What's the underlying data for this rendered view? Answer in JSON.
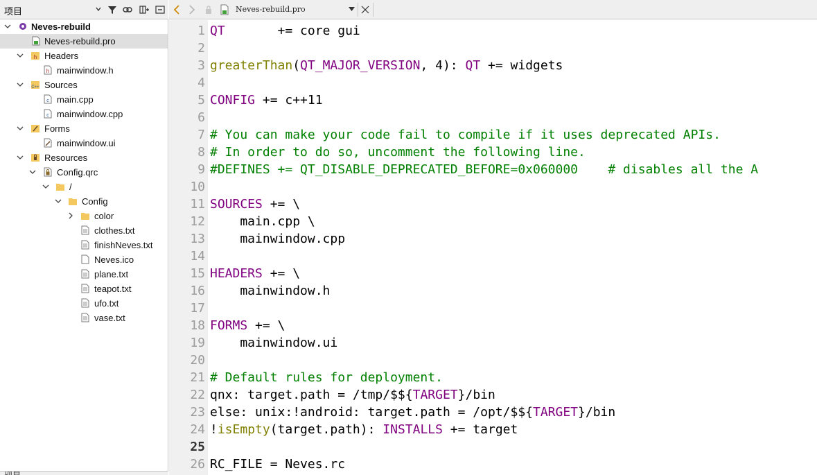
{
  "project_panel": {
    "title": "项目",
    "bottom_title": "项目",
    "tree": [
      {
        "label": "Neves-rebuild",
        "icon": "project-icon",
        "expanded": true,
        "bold": true
      },
      {
        "label": "Neves-rebuild.pro",
        "icon": "pro-file-icon",
        "selected": true
      },
      {
        "label": "Headers",
        "icon": "headers-folder-icon",
        "expanded": true
      },
      {
        "label": "mainwindow.h",
        "icon": "header-file-icon"
      },
      {
        "label": "Sources",
        "icon": "sources-folder-icon",
        "expanded": true
      },
      {
        "label": "main.cpp",
        "icon": "cpp-file-icon"
      },
      {
        "label": "mainwindow.cpp",
        "icon": "cpp-file-icon"
      },
      {
        "label": "Forms",
        "icon": "forms-folder-icon",
        "expanded": true
      },
      {
        "label": "mainwindow.ui",
        "icon": "ui-file-icon"
      },
      {
        "label": "Resources",
        "icon": "resources-folder-icon",
        "expanded": true
      },
      {
        "label": "Config.qrc",
        "icon": "qrc-file-icon",
        "expanded": true
      },
      {
        "label": "/",
        "icon": "folder-icon",
        "expanded": true
      },
      {
        "label": "Config",
        "icon": "folder-icon",
        "expanded": true
      },
      {
        "label": "color",
        "icon": "folder-icon",
        "expanded": false
      },
      {
        "label": "clothes.txt",
        "icon": "text-file-icon"
      },
      {
        "label": "finishNeves.txt",
        "icon": "text-file-icon"
      },
      {
        "label": "Neves.ico",
        "icon": "file-icon"
      },
      {
        "label": "plane.txt",
        "icon": "text-file-icon"
      },
      {
        "label": "teapot.txt",
        "icon": "text-file-icon"
      },
      {
        "label": "ufo.txt",
        "icon": "text-file-icon"
      },
      {
        "label": "vase.txt",
        "icon": "text-file-icon"
      }
    ]
  },
  "editor": {
    "open_file": "Neves-rebuild.pro",
    "current_line": "25",
    "lines": [
      {
        "n": "1",
        "parts": [
          {
            "t": "QT",
            "c": "kw"
          },
          {
            "t": "       += core gui",
            "c": ""
          }
        ]
      },
      {
        "n": "2",
        "parts": []
      },
      {
        "n": "3",
        "parts": [
          {
            "t": "greaterThan",
            "c": "fn"
          },
          {
            "t": "(",
            "c": ""
          },
          {
            "t": "QT_MAJOR_VERSION",
            "c": "kw"
          },
          {
            "t": ", 4): ",
            "c": ""
          },
          {
            "t": "QT",
            "c": "kw"
          },
          {
            "t": " += widgets",
            "c": ""
          }
        ]
      },
      {
        "n": "4",
        "parts": []
      },
      {
        "n": "5",
        "parts": [
          {
            "t": "CONFIG",
            "c": "kw"
          },
          {
            "t": " += c++11",
            "c": ""
          }
        ]
      },
      {
        "n": "6",
        "parts": []
      },
      {
        "n": "7",
        "parts": [
          {
            "t": "# You can make your code fail to compile if it uses deprecated APIs.",
            "c": "cm"
          }
        ]
      },
      {
        "n": "8",
        "parts": [
          {
            "t": "# In order to do so, uncomment the following line.",
            "c": "cm"
          }
        ]
      },
      {
        "n": "9",
        "parts": [
          {
            "t": "#DEFINES += QT_DISABLE_DEPRECATED_BEFORE=0x060000    # disables all the A",
            "c": "cm"
          }
        ]
      },
      {
        "n": "10",
        "parts": []
      },
      {
        "n": "11",
        "parts": [
          {
            "t": "SOURCES",
            "c": "kw"
          },
          {
            "t": " += \\",
            "c": ""
          }
        ]
      },
      {
        "n": "12",
        "parts": [
          {
            "t": "    main.cpp \\",
            "c": ""
          }
        ]
      },
      {
        "n": "13",
        "parts": [
          {
            "t": "    mainwindow.cpp",
            "c": ""
          }
        ]
      },
      {
        "n": "14",
        "parts": []
      },
      {
        "n": "15",
        "parts": [
          {
            "t": "HEADERS",
            "c": "kw"
          },
          {
            "t": " += \\",
            "c": ""
          }
        ]
      },
      {
        "n": "16",
        "parts": [
          {
            "t": "    mainwindow.h",
            "c": ""
          }
        ]
      },
      {
        "n": "17",
        "parts": []
      },
      {
        "n": "18",
        "parts": [
          {
            "t": "FORMS",
            "c": "kw"
          },
          {
            "t": " += \\",
            "c": ""
          }
        ]
      },
      {
        "n": "19",
        "parts": [
          {
            "t": "    mainwindow.ui",
            "c": ""
          }
        ]
      },
      {
        "n": "20",
        "parts": []
      },
      {
        "n": "21",
        "parts": [
          {
            "t": "# Default rules for deployment.",
            "c": "cm"
          }
        ]
      },
      {
        "n": "22",
        "parts": [
          {
            "t": "qnx: target.path = /tmp/$${",
            "c": ""
          },
          {
            "t": "TARGET",
            "c": "kw"
          },
          {
            "t": "}/bin",
            "c": ""
          }
        ]
      },
      {
        "n": "23",
        "parts": [
          {
            "t": "else: unix:!android: target.path = /opt/$${",
            "c": ""
          },
          {
            "t": "TARGET",
            "c": "kw"
          },
          {
            "t": "}/bin",
            "c": ""
          }
        ]
      },
      {
        "n": "24",
        "parts": [
          {
            "t": "!",
            "c": ""
          },
          {
            "t": "isEmpty",
            "c": "fn"
          },
          {
            "t": "(target.path): ",
            "c": ""
          },
          {
            "t": "INSTALLS",
            "c": "kw"
          },
          {
            "t": " += target",
            "c": ""
          }
        ]
      },
      {
        "n": "25",
        "parts": []
      },
      {
        "n": "26",
        "parts": [
          {
            "t": "RC_FILE = Neves.rc",
            "c": ""
          }
        ]
      }
    ]
  },
  "colors": {
    "keyword": "#800080",
    "function": "#808000",
    "comment": "#008000",
    "gutter_bg": "#f0f0f0",
    "selection": "#dfdfdf"
  }
}
